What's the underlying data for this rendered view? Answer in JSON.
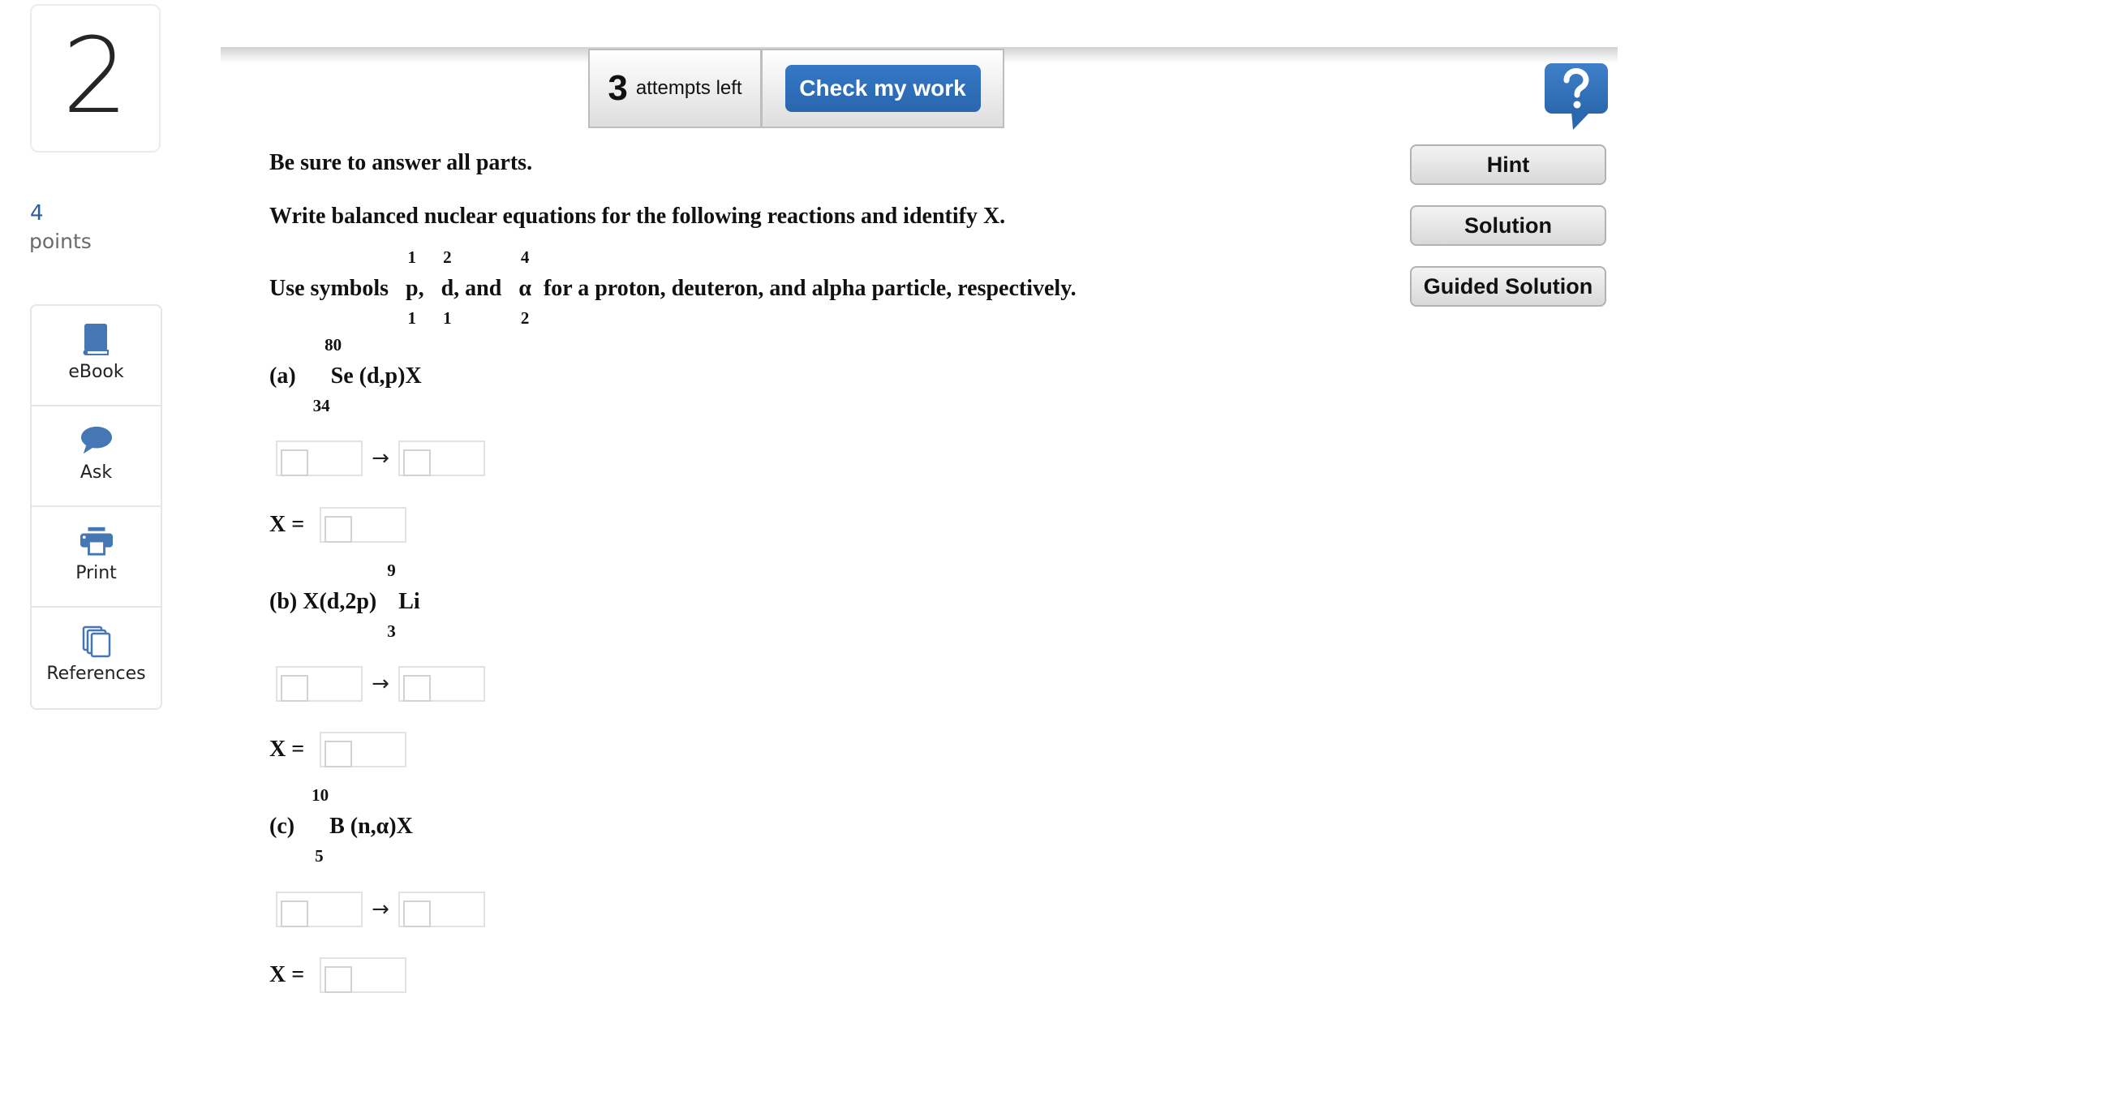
{
  "question": {
    "number": "2",
    "points_value": "4",
    "points_label": "points"
  },
  "sidebar": {
    "items": [
      {
        "label": "eBook",
        "icon": "book-icon"
      },
      {
        "label": "Ask",
        "icon": "speech-bubble-icon"
      },
      {
        "label": "Print",
        "icon": "printer-icon"
      },
      {
        "label": "References",
        "icon": "documents-icon"
      }
    ]
  },
  "toolbar": {
    "attempts_count": "3",
    "attempts_text": "attempts left",
    "check_label": "Check my work",
    "help_icon": "help-question-icon"
  },
  "side_buttons": {
    "hint": "Hint",
    "solution": "Solution",
    "guided_solution": "Guided Solution"
  },
  "instructions": {
    "line1": "Be sure to answer all parts.",
    "line2": "Write balanced nuclear equations for the following reactions and identify X.",
    "line3": {
      "prefix": "Use symbols",
      "proton": {
        "mass": "1",
        "atomic": "1",
        "symbol": "p",
        "after": ","
      },
      "deuteron": {
        "mass": "2",
        "atomic": "1",
        "symbol": "d",
        "after": ", and"
      },
      "alpha": {
        "mass": "4",
        "atomic": "2",
        "symbol": "α",
        "after": ""
      },
      "suffix": "for a proton, deuteron, and alpha particle, respectively."
    }
  },
  "parts": [
    {
      "label": "(a)",
      "pre": "",
      "nuclide": {
        "mass": "80",
        "atomic": "34",
        "symbol": "Se"
      },
      "post": " (d,p)X",
      "arrow": "→",
      "x_label": "X =",
      "left_value": "",
      "right_value": "",
      "x_value": ""
    },
    {
      "label": "(b)",
      "pre": " X(d,2p)",
      "nuclide": {
        "mass": "9",
        "atomic": "3",
        "symbol": "Li"
      },
      "post": "",
      "arrow": "→",
      "x_label": "X =",
      "left_value": "",
      "right_value": "",
      "x_value": ""
    },
    {
      "label": "(c)",
      "pre": "",
      "nuclide": {
        "mass": "10",
        "atomic": "5",
        "symbol": "B"
      },
      "post": " (n,α)X",
      "arrow": "→",
      "x_label": "X =",
      "left_value": "",
      "right_value": "",
      "x_value": ""
    }
  ],
  "colors": {
    "accent": "#2f6fb9",
    "icon_blue": "#4677b5",
    "points_blue": "#2c5f9e"
  }
}
